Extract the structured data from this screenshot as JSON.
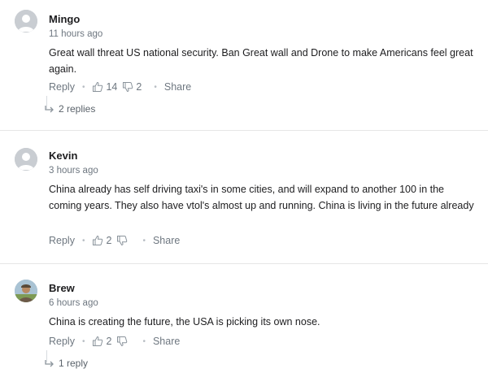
{
  "comments": [
    {
      "author": "Mingo",
      "time": "11 hours ago",
      "text": "Great wall threat US national security. Ban Great wall and Drone to make Americans feel great again.",
      "reply_label": "Reply",
      "upvotes": "14",
      "downvotes": "2",
      "share_label": "Share",
      "replies_label": "2 replies",
      "avatar": "default-avatar-icon"
    },
    {
      "author": "Kevin",
      "time": "3 hours ago",
      "text": "China already has self driving taxi's in some cities, and will expand to another 100 in the coming years. They also have vtol's almost up and running. China is living in the future already",
      "reply_label": "Reply",
      "upvotes": "2",
      "downvotes": "",
      "share_label": "Share",
      "avatar": "default-avatar-icon"
    },
    {
      "author": "Brew",
      "time": "6 hours ago",
      "text": "China is creating the future, the USA is picking its own nose.",
      "reply_label": "Reply",
      "upvotes": "2",
      "downvotes": "",
      "share_label": "Share",
      "replies_label": "1 reply",
      "avatar": "photo-avatar"
    }
  ],
  "colors": {
    "text": "#1d1d1f",
    "muted": "#6e7780",
    "divider": "#e6e6e6",
    "avatar_bg": "#c9cdd2"
  }
}
